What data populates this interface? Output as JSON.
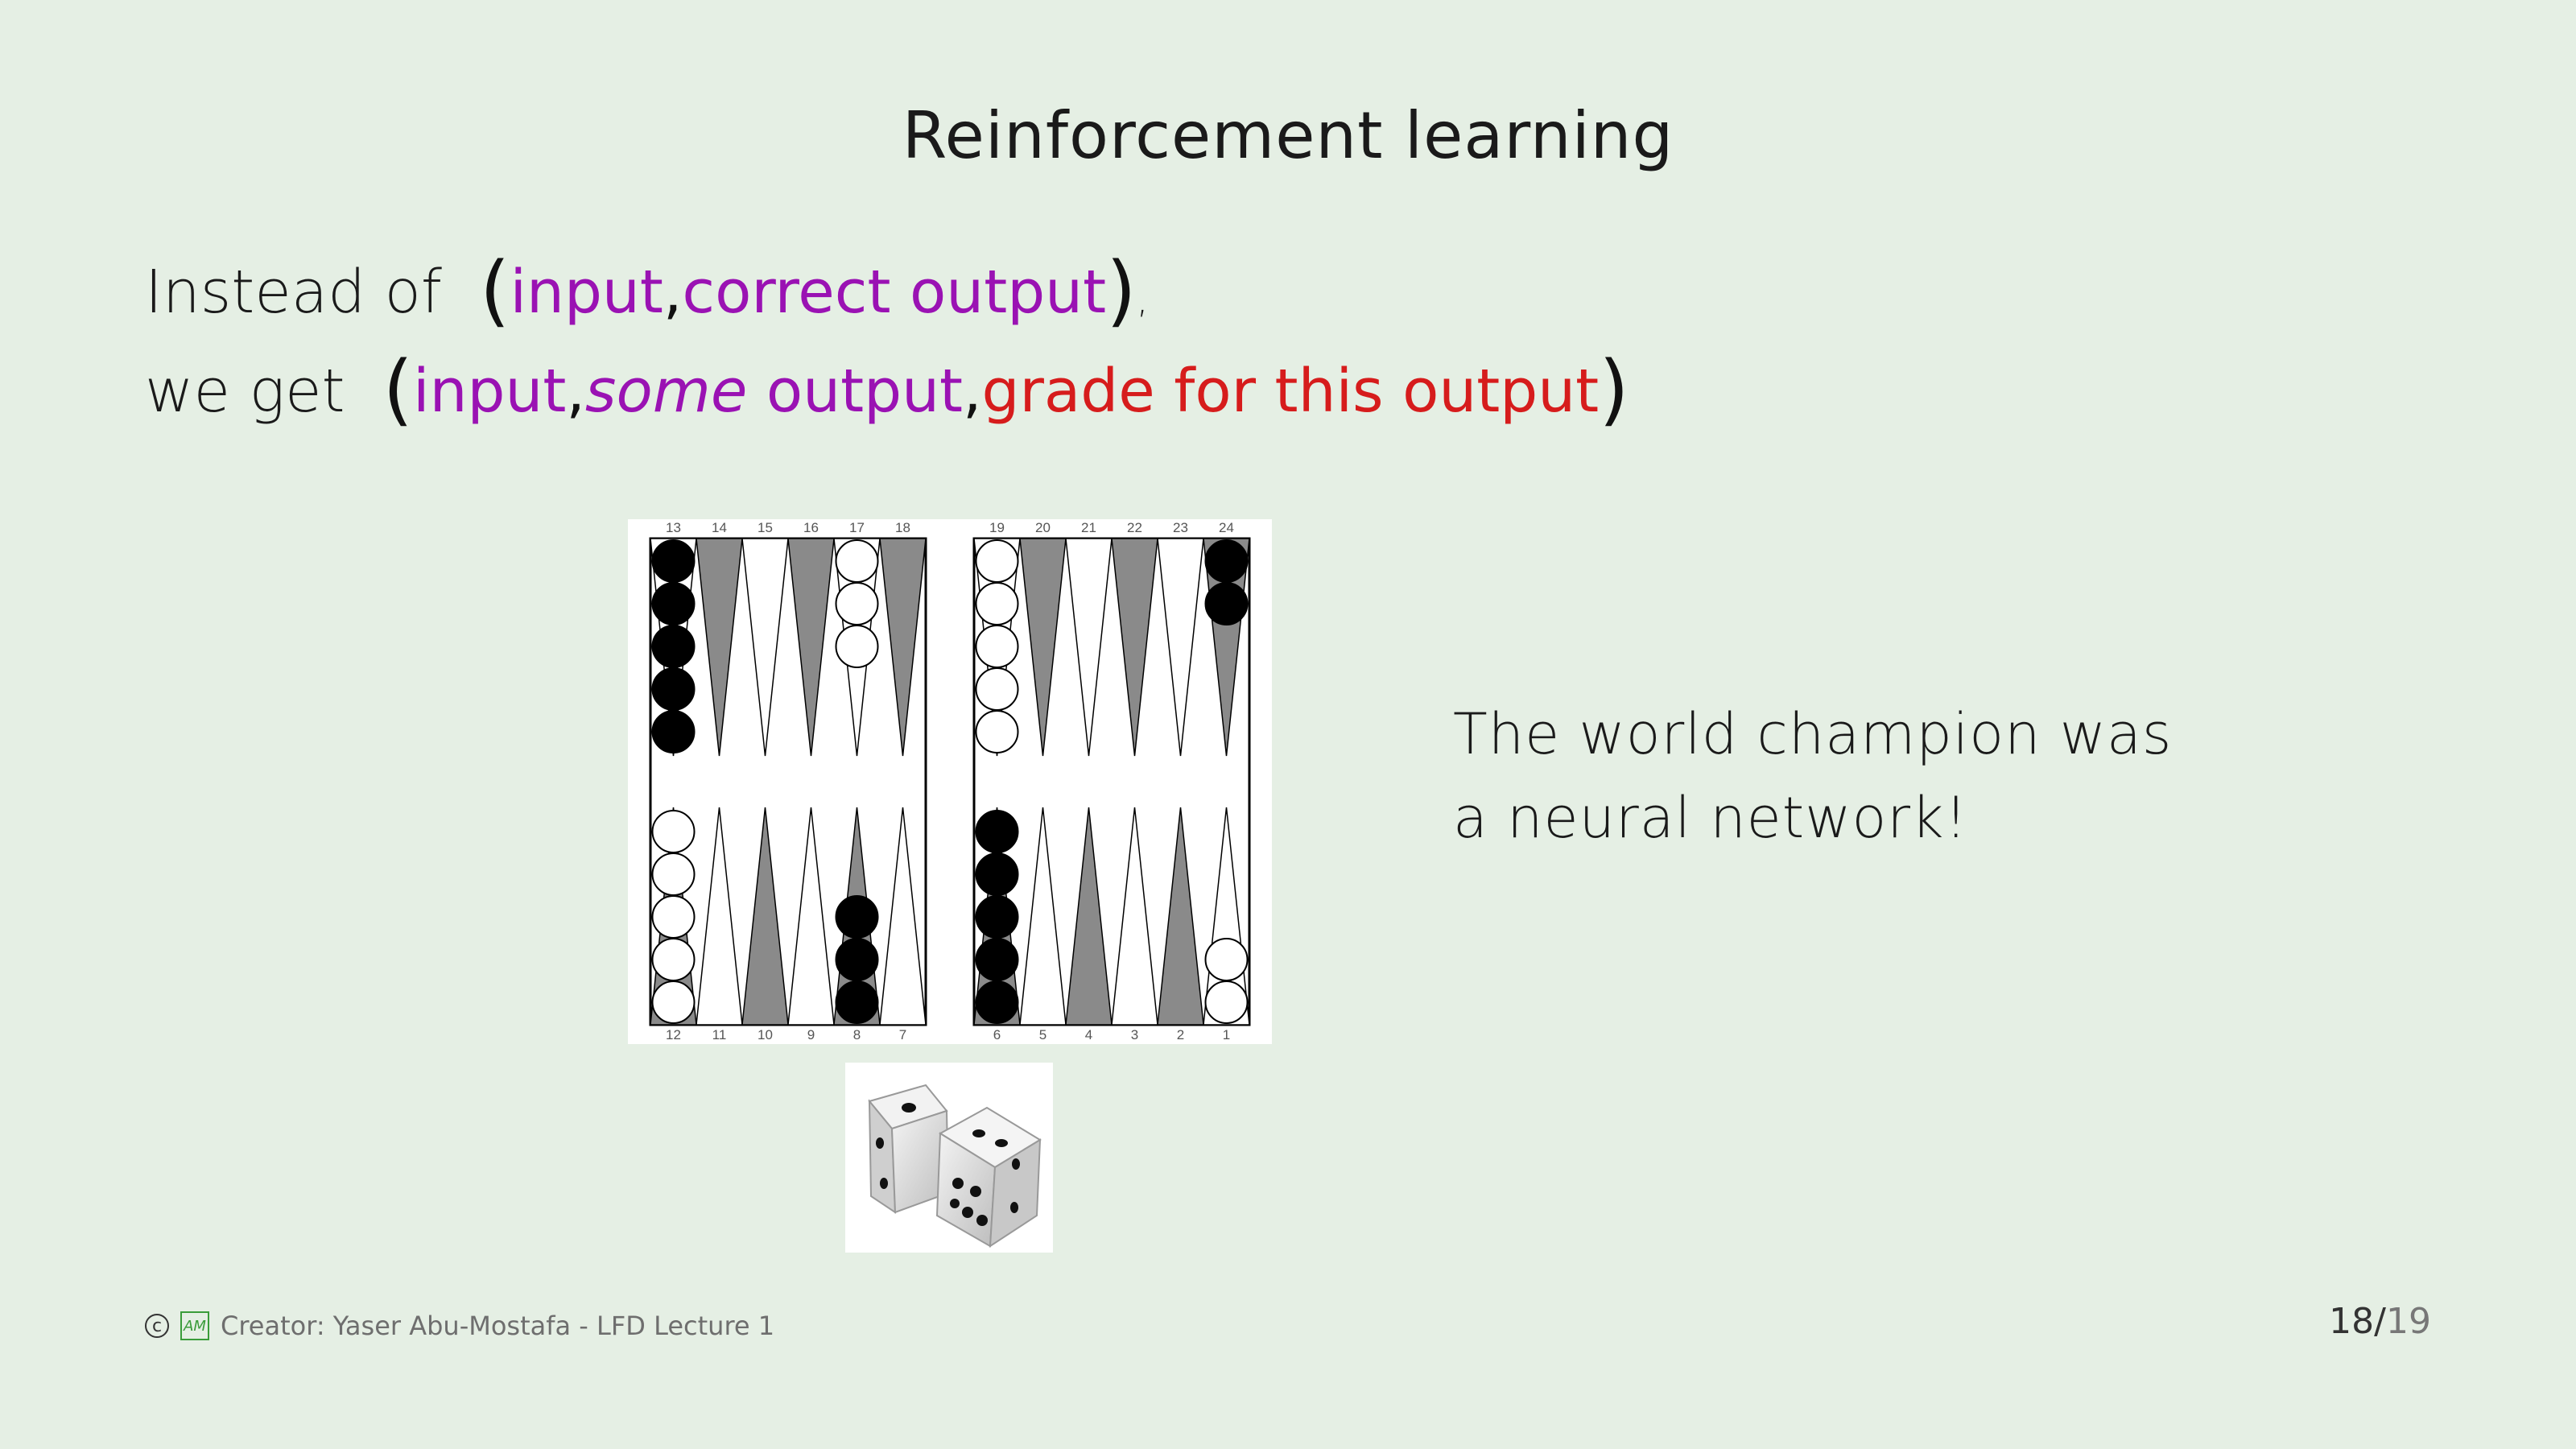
{
  "slide": {
    "title": "Reinforcement learning",
    "line1": {
      "prefix": "Instead of",
      "open": "(",
      "input": "input",
      "comma1": ",",
      "correct_output": "correct output",
      "close": ")",
      "suffix": ","
    },
    "line2": {
      "prefix": "we get",
      "open": "(",
      "input": "input",
      "comma1": ",",
      "some": "some",
      "output": "output",
      "comma2": ",",
      "grade": "grade for this output",
      "close": ")"
    },
    "caption_line1": "The world champion was",
    "caption_line2": "a neural network!"
  },
  "board": {
    "top_numbers": [
      "13",
      "14",
      "15",
      "16",
      "17",
      "18",
      "19",
      "20",
      "21",
      "22",
      "23",
      "24"
    ],
    "bottom_numbers": [
      "12",
      "11",
      "10",
      "9",
      "8",
      "7",
      "6",
      "5",
      "4",
      "3",
      "2",
      "1"
    ]
  },
  "footer": {
    "copyright_symbol": "c",
    "logo_text": "AM",
    "creator": "Creator: Yaser Abu-Mostafa - LFD Lecture 1",
    "page_current": "18",
    "page_total": "19"
  },
  "colors": {
    "background": "#e5efe4",
    "accent_purple": "#9a12b3",
    "accent_red": "#d61c1c"
  }
}
